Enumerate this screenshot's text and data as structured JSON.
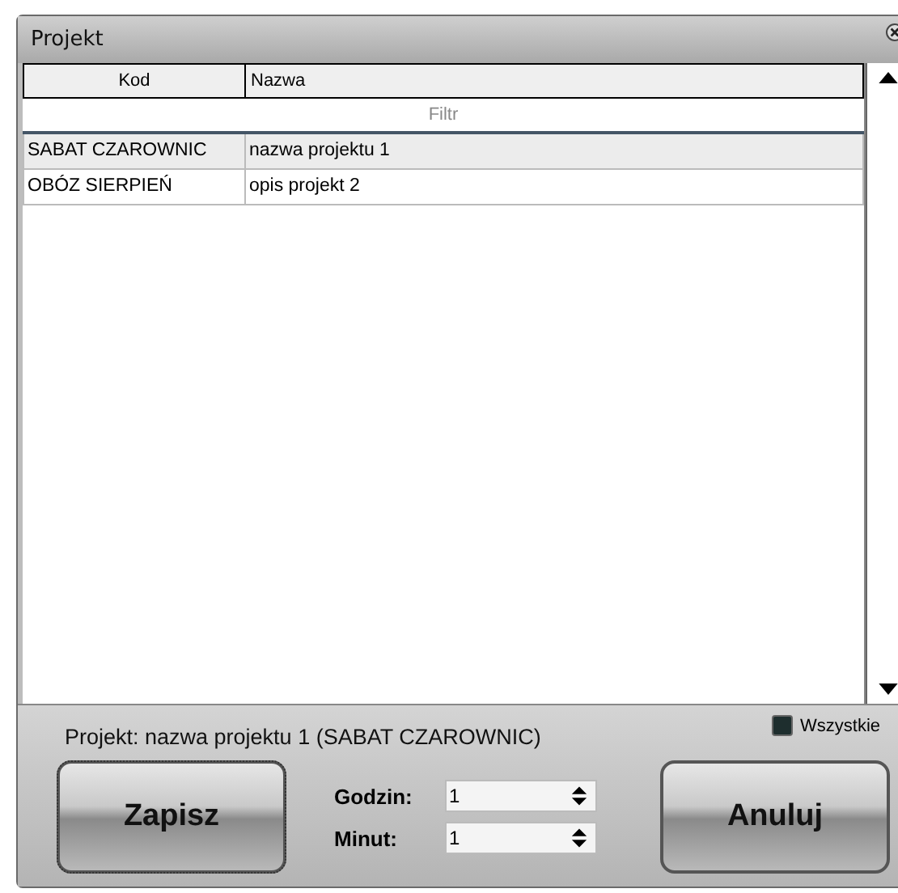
{
  "window": {
    "title": "Projekt"
  },
  "table": {
    "columns": [
      "Kod",
      "Nazwa"
    ],
    "filter": {
      "placeholder": "Filtr"
    },
    "rows": [
      {
        "kod": "SABAT CZAROWNIC",
        "nazwa": "nazwa projektu 1",
        "selected": true
      },
      {
        "kod": "OBÓZ SIERPIEŃ",
        "nazwa": "opis projekt 2",
        "selected": false
      }
    ]
  },
  "footer": {
    "summary": "Projekt: nazwa projektu 1 (SABAT CZAROWNIC)",
    "all": {
      "label": "Wszystkie",
      "checked": false
    },
    "save": "Zapisz",
    "cancel": "Anuluj",
    "fields": [
      {
        "label": "Godzin:",
        "value": "1"
      },
      {
        "label": "Minut:",
        "value": "1"
      }
    ]
  }
}
